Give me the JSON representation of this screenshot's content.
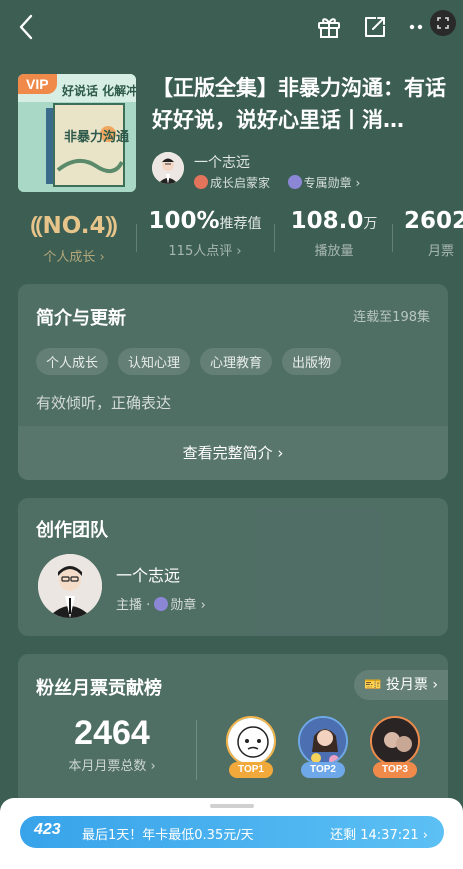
{
  "header": {
    "back_icon": "chevron-left-icon",
    "gift_icon": "gift-icon",
    "share_icon": "share-icon",
    "more_icon": "more-icon"
  },
  "book": {
    "vip_badge": "VIP",
    "cover_text_1": "非暴力沟通",
    "cover_text_top": "好说话 化解冲突",
    "title": "【正版全集】非暴力沟通：有话好好说，说好心里话丨消…",
    "author_name": "一个志远",
    "author_tag_1": "成长启蒙家",
    "author_tag_2": "专属勋章"
  },
  "stats": [
    {
      "big": "NO.4",
      "unit": "",
      "small": "个人成长"
    },
    {
      "big": "100%",
      "unit": "推荐值",
      "small": "115人点评"
    },
    {
      "big": "108.0",
      "unit": "万",
      "small": "播放量"
    },
    {
      "big": "2602",
      "unit": "",
      "small": "月票"
    }
  ],
  "intro": {
    "title": "简介与更新",
    "update_status": "连载至198集",
    "tags": [
      "个人成长",
      "认知心理",
      "心理教育",
      "出版物"
    ],
    "description": "有效倾听，正确表达",
    "more_label": "查看完整简介"
  },
  "team": {
    "title": "创作团队",
    "member_name": "一个志远",
    "member_role": "主播",
    "member_badge": "勋章"
  },
  "fans": {
    "title": "粉丝月票贡献榜",
    "vote_button": "投月票",
    "total_votes": "2464",
    "total_label": "本月月票总数",
    "top_labels": [
      "TOP1",
      "TOP2",
      "TOP3"
    ]
  },
  "promo": {
    "logo": "423",
    "text": "最后1天！年卡最低0.35元/天",
    "timer": "还剩 14:37:21"
  },
  "colors": {
    "background": "#3c5e53",
    "gold": "#e6c48a",
    "promo_blue": "#38a3ea",
    "top1": "#f2a93b",
    "top2": "#6fa8e8",
    "top3": "#f08a4b"
  }
}
